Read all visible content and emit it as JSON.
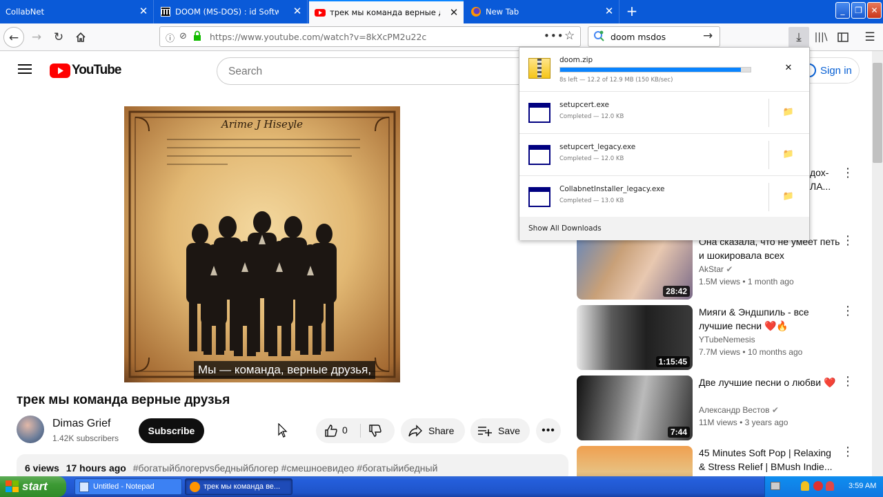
{
  "browser": {
    "tabs": [
      {
        "label": "CollabNet",
        "icon": "no-icon",
        "active": false
      },
      {
        "label": "DOOM (MS-DOS) : id Software : F",
        "icon": "archive-org-icon",
        "active": false
      },
      {
        "label": "трек мы команда верные друзья",
        "icon": "youtube-icon",
        "active": true
      },
      {
        "label": "New Tab",
        "icon": "firefox-icon",
        "active": false
      }
    ],
    "new_tab": "+",
    "url": "https://www.youtube.com/watch?v=8kXcPM2u22c",
    "search_value": "doom msdos",
    "window_buttons": [
      "_",
      "❐",
      "✕"
    ]
  },
  "youtube": {
    "logo_text": "YouTube",
    "search_placeholder": "Search",
    "sign_in": "Sign in",
    "caption": "Мы — команда, верные друзья,",
    "cover_title": "Arime J Hiseyle",
    "video_title": "трек мы команда верные друзья",
    "channel_name": "Dimas Grief",
    "subscribers": "1.42K subscribers",
    "subscribe": "Subscribe",
    "likes": "0",
    "share": "Share",
    "save": "Save",
    "description": {
      "views": "6 views",
      "time": "17 hours ago",
      "tags": "#богатыйблогерvsбедныйблогер #смешноевидео #богатыйибедный"
    },
    "related": [
      {
        "title": "...дох-\n...ЛА...",
        "channel": "",
        "meta": "",
        "duration": ""
      },
      {
        "title": "Она сказала, что не умеет петь и шокировала всех",
        "channel": "AkStar",
        "verified": true,
        "views": "1.5M views",
        "age": "1 month ago",
        "duration": "28:42"
      },
      {
        "title": "Мияги & Эндшпиль - все лучшие песни ❤️🔥",
        "channel": "YTubeNemesis",
        "verified": false,
        "views": "7.7M views",
        "age": "10 months ago",
        "duration": "1:15:45"
      },
      {
        "title": "Две лучшие песни о любви ❤️",
        "channel": "Александр Вестов",
        "verified": true,
        "views": "11M views",
        "age": "3 years ago",
        "duration": "7:44"
      },
      {
        "title": "45 Minutes Soft Pop | Relaxing & Stress Relief | BMush Indie...",
        "channel": "",
        "verified": false,
        "views": "",
        "age": "",
        "duration": ""
      }
    ]
  },
  "downloads": {
    "items": [
      {
        "name": "doom.zip",
        "status": "8s left — 12.2 of 12.9 MB (150 KB/sec)",
        "progress": 0.95,
        "action": "✕"
      },
      {
        "name": "setupcert.exe",
        "status": "Completed — 12.0 KB",
        "action": "📁"
      },
      {
        "name": "setupcert_legacy.exe",
        "status": "Completed — 12.0 KB",
        "action": "📁"
      },
      {
        "name": "CollabnetInstaller_legacy.exe",
        "status": "Completed — 13.0 KB",
        "action": "📁"
      }
    ],
    "show_all": "Show All Downloads"
  },
  "taskbar": {
    "start": "start",
    "tasks": [
      {
        "label": "Untitled - Notepad",
        "active": false
      },
      {
        "label": "трек мы команда ве...",
        "active": true
      }
    ],
    "clock": "3:59 AM"
  }
}
